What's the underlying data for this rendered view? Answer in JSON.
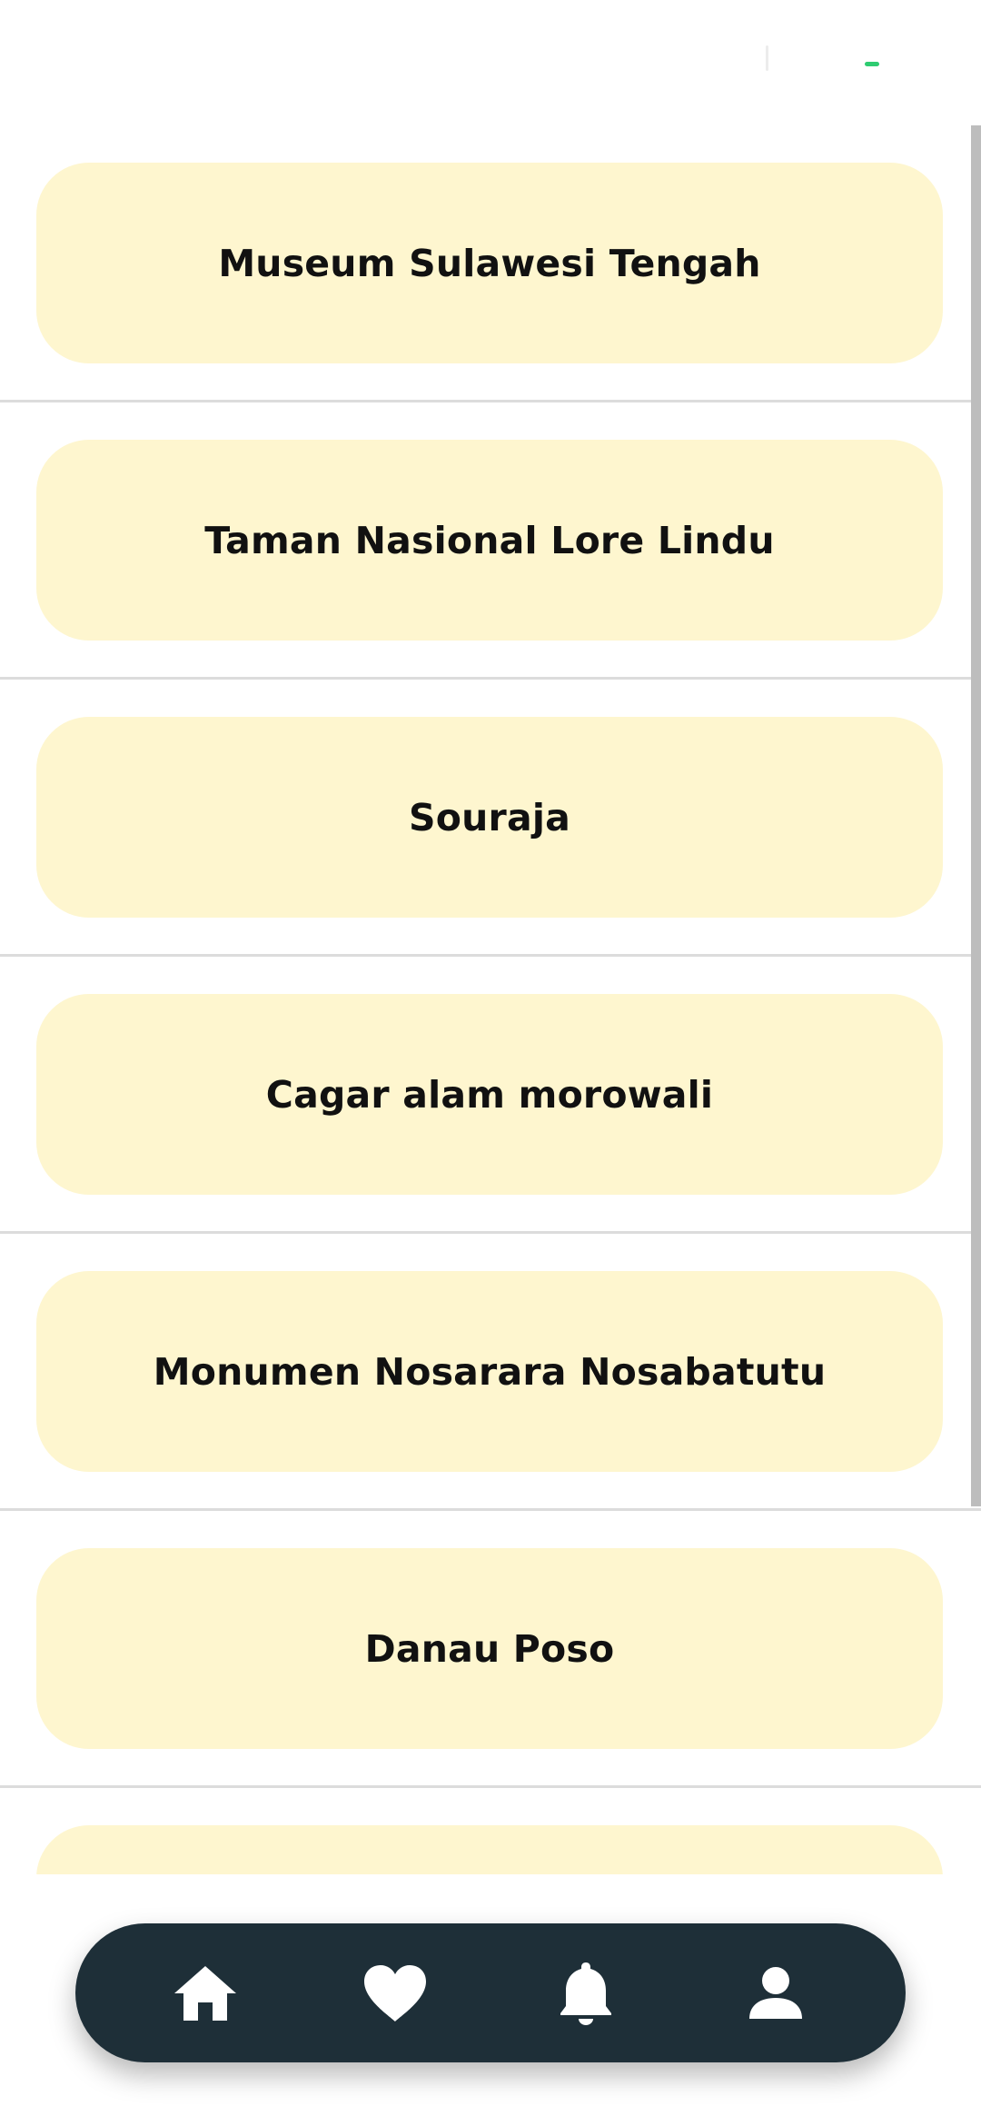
{
  "places": [
    {
      "label": "Museum Sulawesi Tengah"
    },
    {
      "label": "Taman Nasional Lore Lindu"
    },
    {
      "label": "Souraja"
    },
    {
      "label": "Cagar alam morowali"
    },
    {
      "label": "Monumen Nosarara Nosabatutu"
    },
    {
      "label": "Danau Poso"
    },
    {
      "label": ""
    }
  ],
  "bottom_nav": {
    "items": [
      {
        "icon": "home-icon"
      },
      {
        "icon": "heart-icon"
      },
      {
        "icon": "bell-icon"
      },
      {
        "icon": "person-icon"
      }
    ]
  },
  "colors": {
    "card_background": "#fef6cf",
    "nav_background": "#1e2f38",
    "status_accent": "#2ecc71"
  }
}
